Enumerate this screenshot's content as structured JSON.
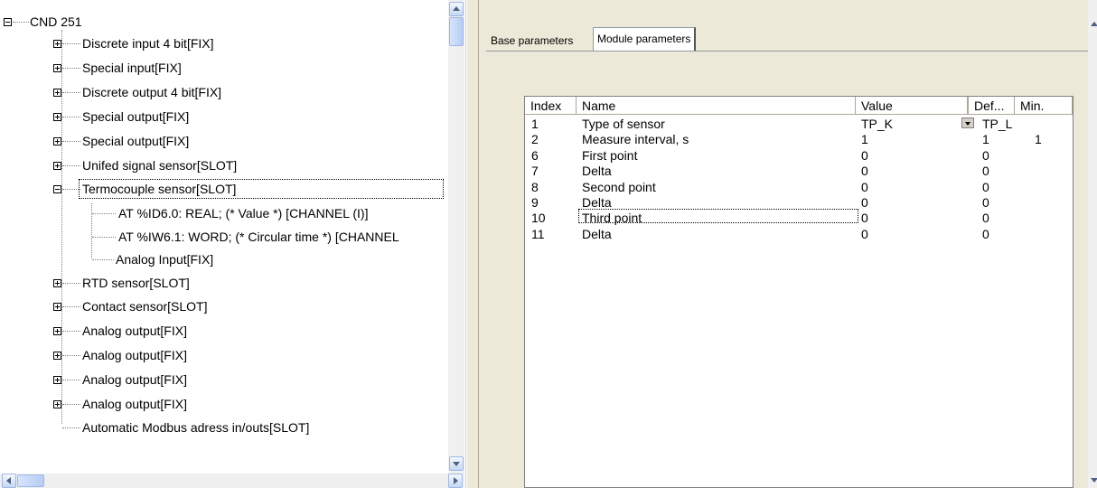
{
  "tree": {
    "items": [
      {
        "label": "CND 251"
      },
      {
        "label": "Discrete input 4 bit[FIX]"
      },
      {
        "label": "Special input[FIX]"
      },
      {
        "label": "Discrete output 4 bit[FIX]"
      },
      {
        "label": "Special output[FIX]"
      },
      {
        "label": "Special output[FIX]"
      },
      {
        "label": "Unifed signal sensor[SLOT]"
      },
      {
        "label": "Termocouple sensor[SLOT]"
      },
      {
        "label": "AT %ID6.0: REAL; (* Value *) [CHANNEL (I)]"
      },
      {
        "label": "AT %IW6.1: WORD; (* Circular time *) [CHANNEL"
      },
      {
        "label": "Analog Input[FIX]"
      },
      {
        "label": "RTD sensor[SLOT]"
      },
      {
        "label": "Contact sensor[SLOT]"
      },
      {
        "label": "Analog output[FIX]"
      },
      {
        "label": "Analog output[FIX]"
      },
      {
        "label": "Analog output[FIX]"
      },
      {
        "label": "Analog output[FIX]"
      },
      {
        "label": "Automatic Modbus adress in/outs[SLOT]"
      }
    ]
  },
  "tabs": {
    "base": "Base parameters",
    "module": "Module parameters"
  },
  "grid": {
    "headers": {
      "index": "Index",
      "name": "Name",
      "value": "Value",
      "def": "Def...",
      "min": "Min."
    },
    "rows": [
      {
        "index": "1",
        "name": "Type of sensor",
        "value": "TP_K",
        "def": "TP_L",
        "min": ""
      },
      {
        "index": "2",
        "name": "Measure interval, s",
        "value": "1",
        "def": "1",
        "min": "1"
      },
      {
        "index": "6",
        "name": "First point",
        "value": "0",
        "def": "0",
        "min": ""
      },
      {
        "index": "7",
        "name": "Delta",
        "value": "0",
        "def": "0",
        "min": ""
      },
      {
        "index": "8",
        "name": "Second point",
        "value": "0",
        "def": "0",
        "min": ""
      },
      {
        "index": "9",
        "name": "Delta",
        "value": "0",
        "def": "0",
        "min": ""
      },
      {
        "index": "10",
        "name": "Third point",
        "value": "0",
        "def": "0",
        "min": ""
      },
      {
        "index": "11",
        "name": "Delta",
        "value": "0",
        "def": "0",
        "min": ""
      }
    ]
  },
  "colors": {
    "window_bg": "#ece9d8",
    "scroll_accent": "#c6d7f3"
  }
}
